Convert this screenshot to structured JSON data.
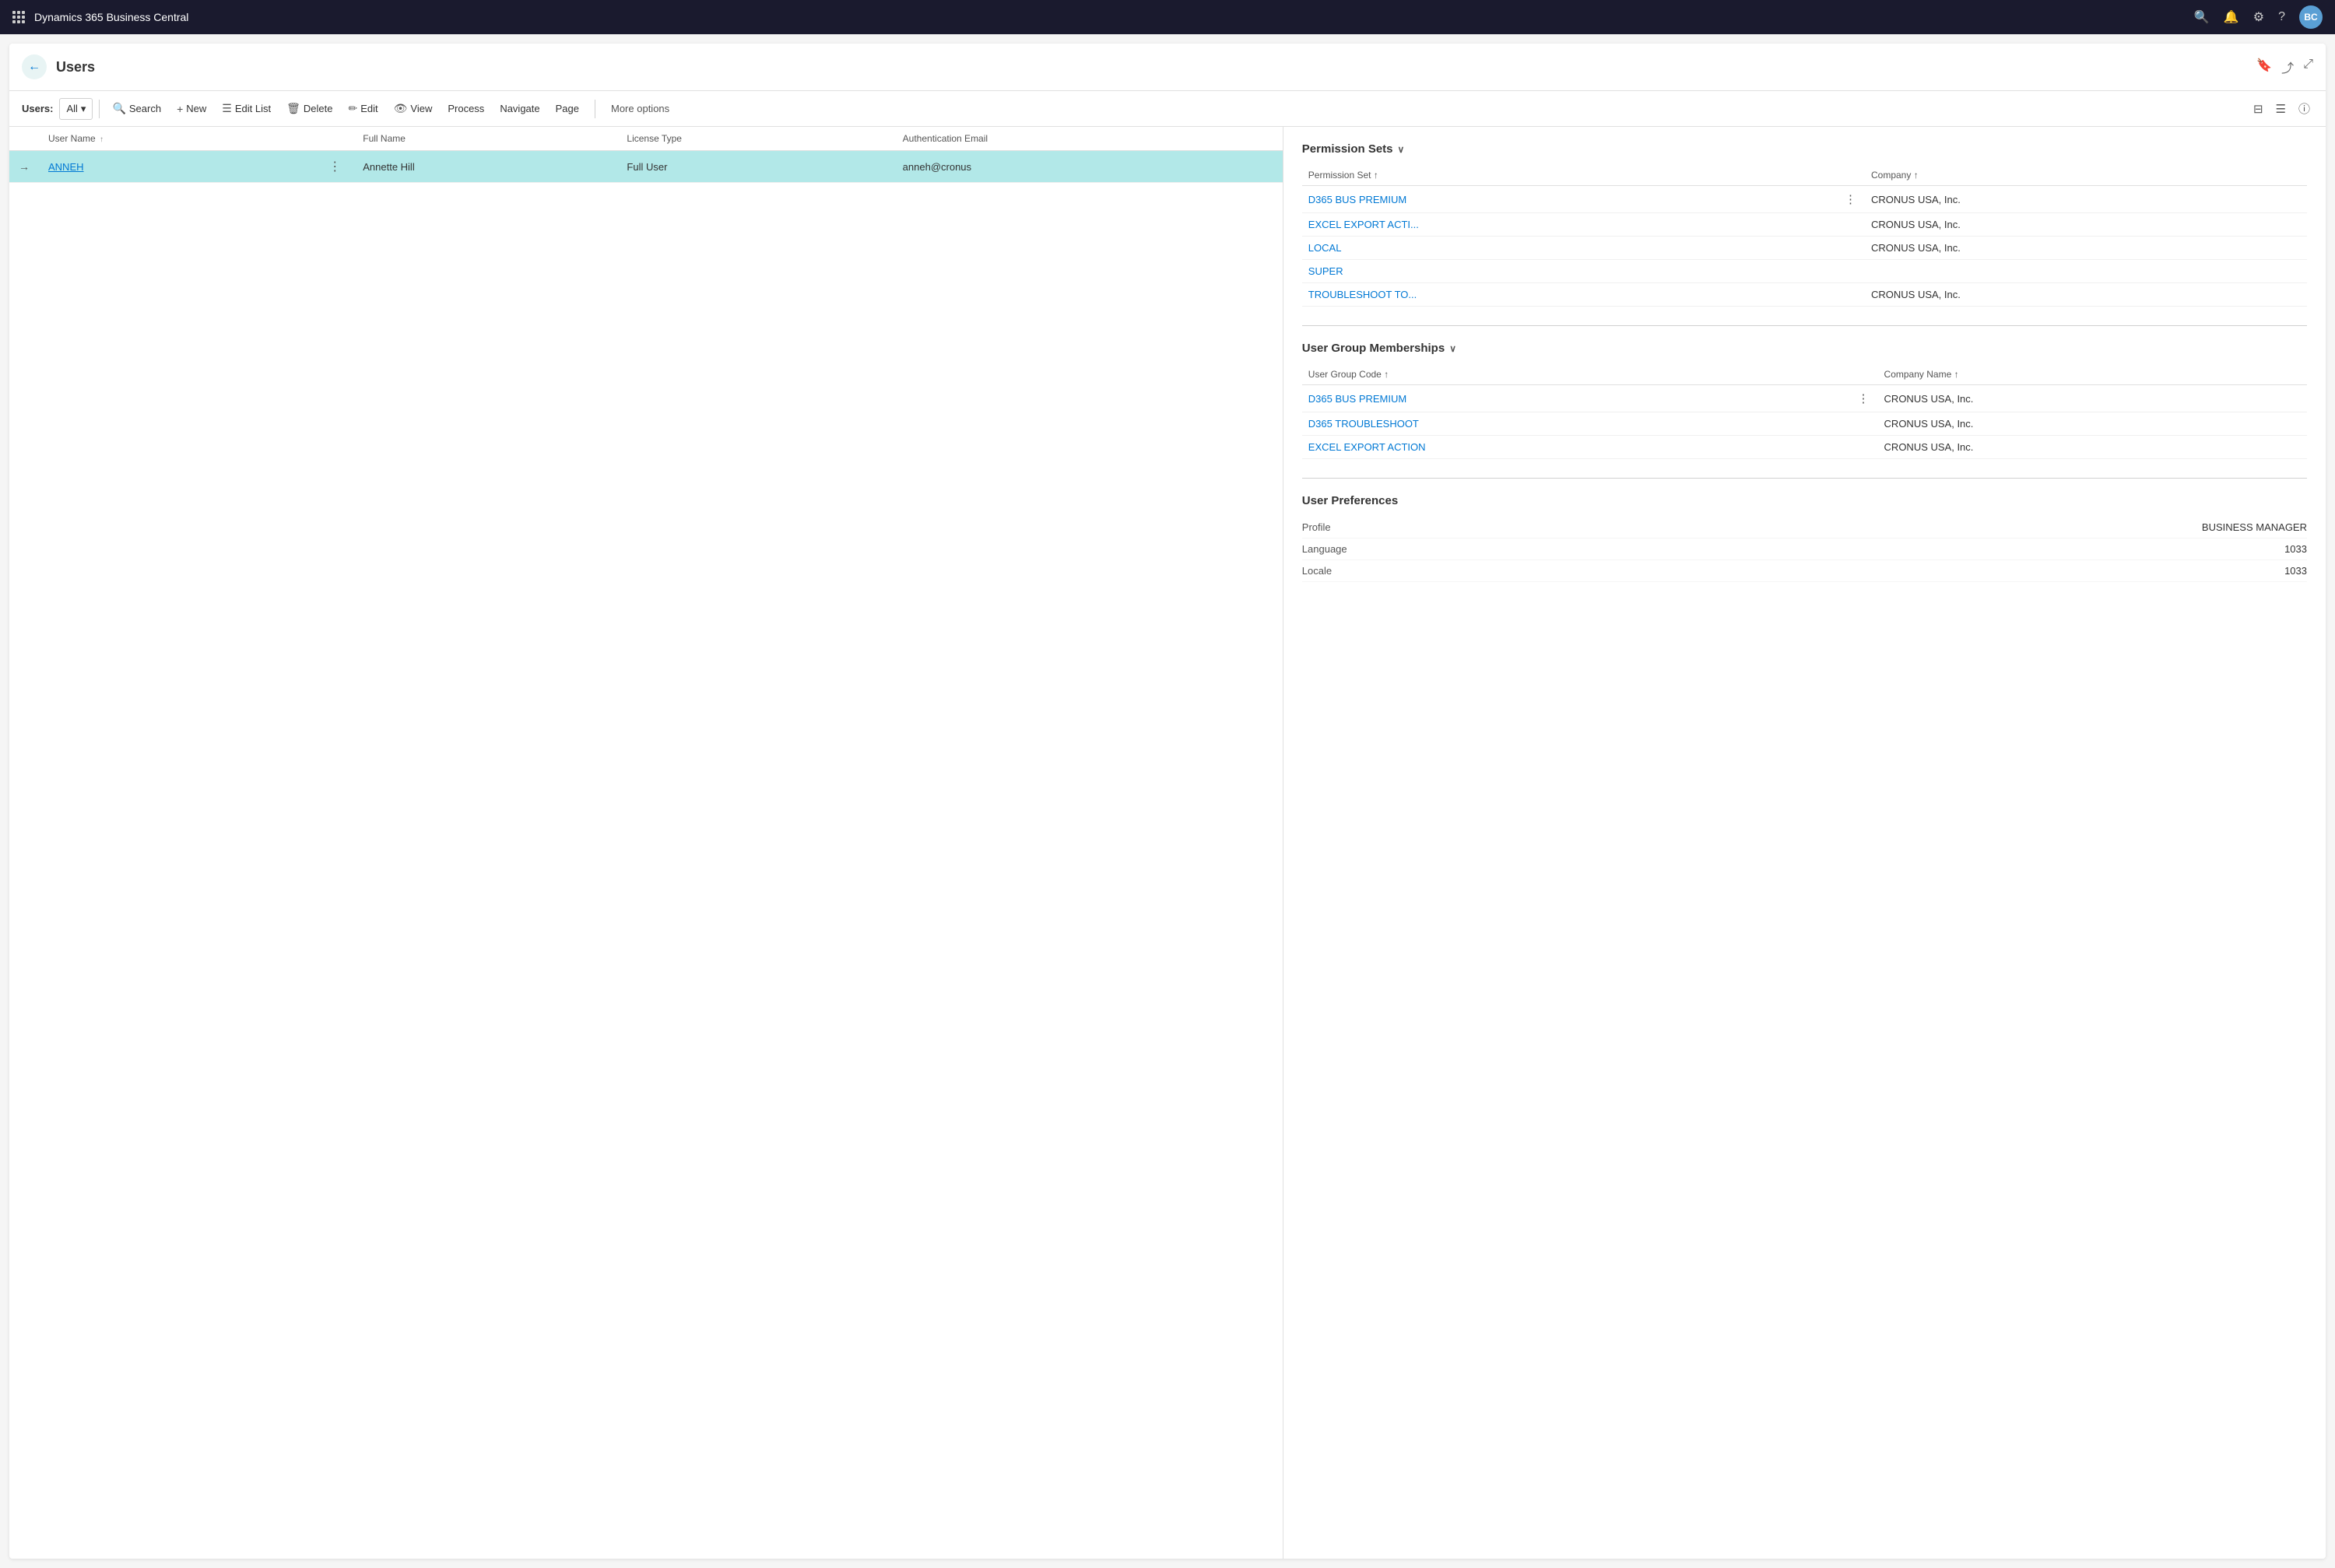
{
  "app": {
    "title": "Dynamics 365 Business Central",
    "avatar_initials": "BC",
    "avatar_bg": "#5a9fd4"
  },
  "page": {
    "title": "Users",
    "back_label": "←",
    "bookmark_icon": "🔖",
    "share_icon": "⤴",
    "expand_icon": "⤢"
  },
  "toolbar": {
    "filter_label": "Users:",
    "filter_value": "All",
    "search_label": "Search",
    "new_label": "New",
    "edit_list_label": "Edit List",
    "delete_label": "Delete",
    "edit_label": "Edit",
    "view_label": "View",
    "process_label": "Process",
    "navigate_label": "Navigate",
    "page_label": "Page",
    "more_options_label": "More options"
  },
  "users_table": {
    "columns": [
      {
        "key": "user_name",
        "label": "User Name",
        "sort": "↑"
      },
      {
        "key": "full_name",
        "label": "Full Name"
      },
      {
        "key": "license_type",
        "label": "License Type"
      },
      {
        "key": "auth_email",
        "label": "Authentication Email"
      }
    ],
    "rows": [
      {
        "user_name": "ANNEH",
        "full_name": "Annette Hill",
        "license_type": "Full User",
        "auth_email": "anneh@cronus",
        "selected": true
      }
    ]
  },
  "permission_sets": {
    "section_title": "Permission Sets",
    "columns": [
      {
        "key": "permission_set",
        "label": "Permission Set",
        "sort": "↑"
      },
      {
        "key": "company",
        "label": "Company",
        "sort": "↑"
      }
    ],
    "rows": [
      {
        "permission_set": "D365 BUS PREMIUM",
        "company": "CRONUS USA, Inc.",
        "has_menu": true
      },
      {
        "permission_set": "EXCEL EXPORT ACTI...",
        "company": "CRONUS USA, Inc.",
        "has_menu": false
      },
      {
        "permission_set": "LOCAL",
        "company": "CRONUS USA, Inc.",
        "has_menu": false
      },
      {
        "permission_set": "SUPER",
        "company": "",
        "has_menu": false
      },
      {
        "permission_set": "TROUBLESHOOT TO...",
        "company": "CRONUS USA, Inc.",
        "has_menu": false
      }
    ]
  },
  "user_group_memberships": {
    "section_title": "User Group Memberships",
    "columns": [
      {
        "key": "user_group_code",
        "label": "User Group Code",
        "sort": "↑"
      },
      {
        "key": "company_name",
        "label": "Company Name",
        "sort": "↑"
      }
    ],
    "rows": [
      {
        "user_group_code": "D365 BUS PREMIUM",
        "company_name": "CRONUS USA, Inc.",
        "has_menu": true
      },
      {
        "user_group_code": "D365 TROUBLESHOOT",
        "company_name": "CRONUS USA, Inc.",
        "has_menu": false
      },
      {
        "user_group_code": "EXCEL EXPORT ACTION",
        "company_name": "CRONUS USA, Inc.",
        "has_menu": false
      }
    ]
  },
  "user_preferences": {
    "section_title": "User Preferences",
    "rows": [
      {
        "label": "Profile",
        "value": "BUSINESS MANAGER"
      },
      {
        "label": "Language",
        "value": "1033"
      },
      {
        "label": "Locale",
        "value": "1033"
      }
    ]
  }
}
